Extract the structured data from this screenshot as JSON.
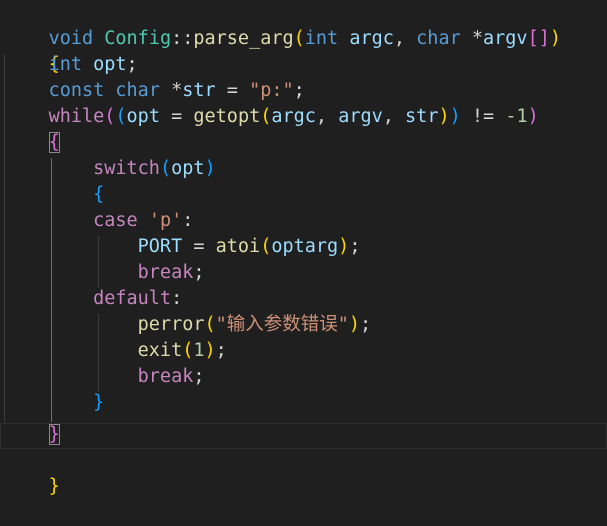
{
  "code": {
    "l1": {
      "kw_void": "void",
      "cls": "Config",
      "scope": "::",
      "fn": "parse_arg",
      "open": "(",
      "kw_int": "int",
      "argc": "argc",
      "comma": ", ",
      "kw_char": "char",
      "star": " *",
      "argv": "argv",
      "br": "[]",
      "close": ")"
    },
    "l2": {
      "brace": "{"
    },
    "l3": {
      "kw_int": "int",
      "opt": "opt",
      "semi": ";"
    },
    "l4": {
      "kw_const": "const",
      "kw_char": "char",
      "star": " *",
      "str": "str",
      "eq": " = ",
      "lit": "\"p:\"",
      "semi": ";"
    },
    "l5": {
      "kw_while": "while",
      "p1": "(",
      "p2": "(",
      "opt": "opt",
      "eq": " = ",
      "fn": "getopt",
      "p3": "(",
      "argc": "argc",
      "c1": ", ",
      "argv": "argv",
      "c2": ", ",
      "str": "str",
      "p3c": ")",
      "p2c": ")",
      "ne": " != ",
      "num": "-1",
      "p1c": ")"
    },
    "l6": {
      "brace": "{"
    },
    "l7": {
      "kw_switch": "switch",
      "open": "(",
      "opt": "opt",
      "close": ")"
    },
    "l8": {
      "brace": "{"
    },
    "l9": {
      "kw_case": "case",
      "lit": "'p'",
      "colon": ":"
    },
    "l10": {
      "port": "PORT",
      "eq": " = ",
      "fn": "atoi",
      "open": "(",
      "arg": "optarg",
      "close": ")",
      "semi": ";"
    },
    "l11": {
      "kw_break": "break",
      "semi": ";"
    },
    "l12": {
      "kw_default": "default",
      "colon": ":"
    },
    "l13": {
      "fn": "perror",
      "open": "(",
      "lit": "\"输入参数错误\"",
      "close": ")",
      "semi": ";"
    },
    "l14": {
      "fn": "exit",
      "open": "(",
      "num": "1",
      "close": ")",
      "semi": ";"
    },
    "l15": {
      "kw_break": "break",
      "semi": ";"
    },
    "l16": {
      "brace": "}"
    },
    "l17": {
      "brace": "}"
    },
    "l18": {
      "brace": "}"
    }
  }
}
